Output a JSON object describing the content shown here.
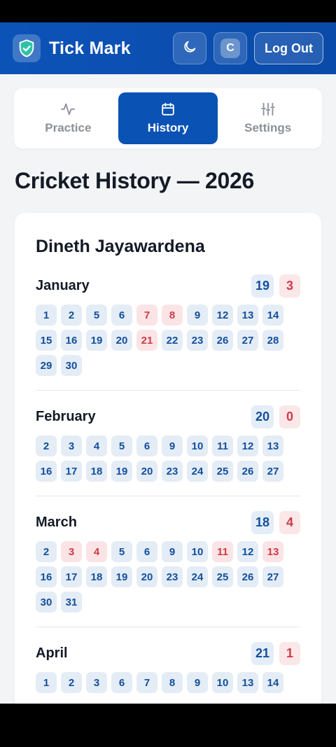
{
  "app": {
    "title": "Tick Mark",
    "avatar_letter": "C",
    "logout_label": "Log Out"
  },
  "tabs": [
    {
      "label": "Practice",
      "icon": "activity-icon",
      "active": false
    },
    {
      "label": "History",
      "icon": "calendar-icon",
      "active": true
    },
    {
      "label": "Settings",
      "icon": "sliders-icon",
      "active": false
    }
  ],
  "page_title": "Cricket History — 2026",
  "player_name": "Dineth Jayawardena",
  "colors": {
    "brand": "#0a52b4",
    "present": "#124f9c",
    "absent": "#d03a48"
  },
  "months": [
    {
      "name": "January",
      "present": "19",
      "absent": "3",
      "days": [
        {
          "d": "1",
          "miss": false
        },
        {
          "d": "2",
          "miss": false
        },
        {
          "d": "5",
          "miss": false
        },
        {
          "d": "6",
          "miss": false
        },
        {
          "d": "7",
          "miss": true
        },
        {
          "d": "8",
          "miss": true
        },
        {
          "d": "9",
          "miss": false
        },
        {
          "d": "12",
          "miss": false
        },
        {
          "d": "13",
          "miss": false
        },
        {
          "d": "14",
          "miss": false
        },
        {
          "d": "15",
          "miss": false
        },
        {
          "d": "16",
          "miss": false
        },
        {
          "d": "19",
          "miss": false
        },
        {
          "d": "20",
          "miss": false
        },
        {
          "d": "21",
          "miss": true
        },
        {
          "d": "22",
          "miss": false
        },
        {
          "d": "23",
          "miss": false
        },
        {
          "d": "26",
          "miss": false
        },
        {
          "d": "27",
          "miss": false
        },
        {
          "d": "28",
          "miss": false
        },
        {
          "d": "29",
          "miss": false
        },
        {
          "d": "30",
          "miss": false
        }
      ]
    },
    {
      "name": "February",
      "present": "20",
      "absent": "0",
      "days": [
        {
          "d": "2",
          "miss": false
        },
        {
          "d": "3",
          "miss": false
        },
        {
          "d": "4",
          "miss": false
        },
        {
          "d": "5",
          "miss": false
        },
        {
          "d": "6",
          "miss": false
        },
        {
          "d": "9",
          "miss": false
        },
        {
          "d": "10",
          "miss": false
        },
        {
          "d": "11",
          "miss": false
        },
        {
          "d": "12",
          "miss": false
        },
        {
          "d": "13",
          "miss": false
        },
        {
          "d": "16",
          "miss": false
        },
        {
          "d": "17",
          "miss": false
        },
        {
          "d": "18",
          "miss": false
        },
        {
          "d": "19",
          "miss": false
        },
        {
          "d": "20",
          "miss": false
        },
        {
          "d": "23",
          "miss": false
        },
        {
          "d": "24",
          "miss": false
        },
        {
          "d": "25",
          "miss": false
        },
        {
          "d": "26",
          "miss": false
        },
        {
          "d": "27",
          "miss": false
        }
      ]
    },
    {
      "name": "March",
      "present": "18",
      "absent": "4",
      "days": [
        {
          "d": "2",
          "miss": false
        },
        {
          "d": "3",
          "miss": true
        },
        {
          "d": "4",
          "miss": true
        },
        {
          "d": "5",
          "miss": false
        },
        {
          "d": "6",
          "miss": false
        },
        {
          "d": "9",
          "miss": false
        },
        {
          "d": "10",
          "miss": false
        },
        {
          "d": "11",
          "miss": true
        },
        {
          "d": "12",
          "miss": false
        },
        {
          "d": "13",
          "miss": true
        },
        {
          "d": "16",
          "miss": false
        },
        {
          "d": "17",
          "miss": false
        },
        {
          "d": "18",
          "miss": false
        },
        {
          "d": "19",
          "miss": false
        },
        {
          "d": "20",
          "miss": false
        },
        {
          "d": "23",
          "miss": false
        },
        {
          "d": "24",
          "miss": false
        },
        {
          "d": "25",
          "miss": false
        },
        {
          "d": "26",
          "miss": false
        },
        {
          "d": "27",
          "miss": false
        },
        {
          "d": "30",
          "miss": false
        },
        {
          "d": "31",
          "miss": false
        }
      ]
    },
    {
      "name": "April",
      "present": "21",
      "absent": "1",
      "days": [
        {
          "d": "1",
          "miss": false
        },
        {
          "d": "2",
          "miss": false
        },
        {
          "d": "3",
          "miss": false
        },
        {
          "d": "6",
          "miss": false
        },
        {
          "d": "7",
          "miss": false
        },
        {
          "d": "8",
          "miss": false
        },
        {
          "d": "9",
          "miss": false
        },
        {
          "d": "10",
          "miss": false
        },
        {
          "d": "13",
          "miss": false
        },
        {
          "d": "14",
          "miss": false
        }
      ]
    }
  ]
}
